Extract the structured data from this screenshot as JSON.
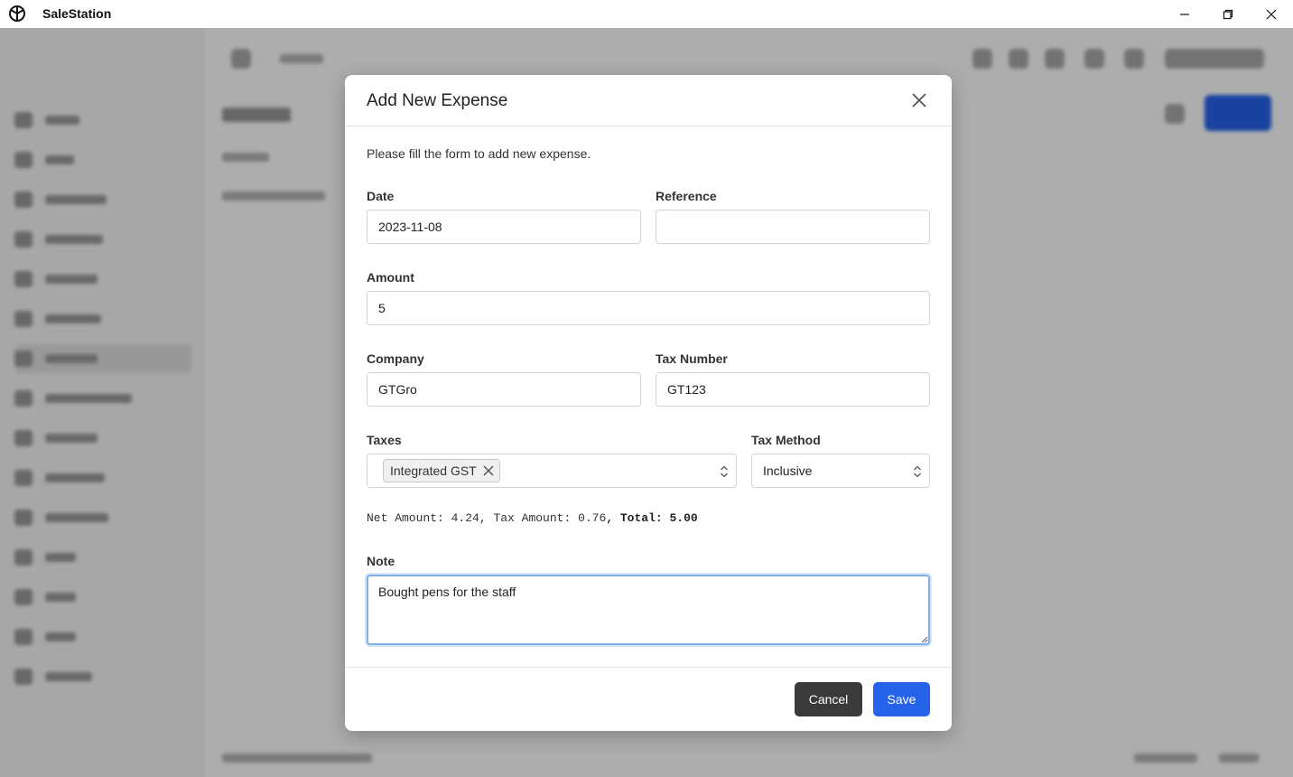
{
  "window": {
    "app_title": "SaleStation",
    "controls": [
      "minimize-icon",
      "maximize-icon",
      "close-icon"
    ]
  },
  "modal": {
    "title": "Add New Expense",
    "intro": "Please fill the form to add new expense.",
    "fields": {
      "date": {
        "label": "Date",
        "value": "2023-11-08"
      },
      "reference": {
        "label": "Reference",
        "value": ""
      },
      "amount": {
        "label": "Amount",
        "value": "5"
      },
      "company": {
        "label": "Company",
        "value": "GTGro"
      },
      "tax_number": {
        "label": "Tax Number",
        "value": "GT123"
      },
      "taxes": {
        "label": "Taxes",
        "selected": [
          "Integrated GST"
        ]
      },
      "tax_method": {
        "label": "Tax Method",
        "value": "Inclusive"
      },
      "note": {
        "label": "Note",
        "value": "Bought pens for the staff"
      }
    },
    "summary": {
      "net_label": "Net Amount: ",
      "net": "4.24",
      "tax_label": ", Tax Amount: ",
      "tax": "0.76",
      "total_label": ", Total: 5.00"
    },
    "buttons": {
      "cancel": "Cancel",
      "save": "Save"
    }
  },
  "theme": {
    "primary": "#2563eb",
    "cancel": "#3a3a3a",
    "focus": "#7fb0e6"
  }
}
